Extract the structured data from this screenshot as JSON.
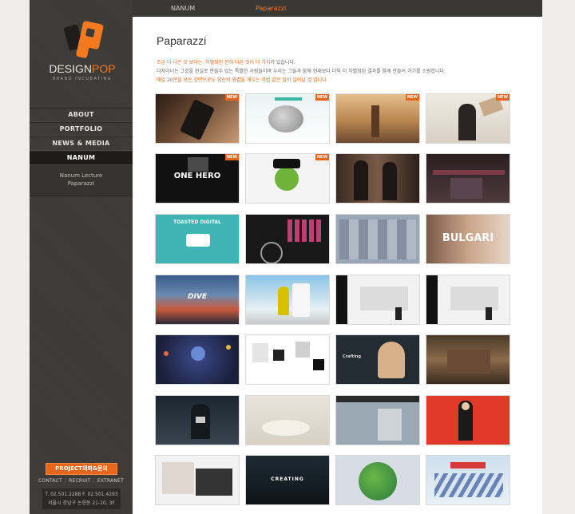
{
  "topbar": {
    "tabs": [
      {
        "label": "NANUM",
        "color": "#d2cdc5"
      },
      {
        "label": "Paparazzi",
        "color": "#f47a1f"
      }
    ]
  },
  "sidebar": {
    "logo": {
      "word1": "DESIGN",
      "word2": "POP",
      "tagline": "BRAND INCUBATING"
    },
    "nav": [
      {
        "label": "ABOUT"
      },
      {
        "label": "PORTFOLIO"
      },
      {
        "label": "NEWS & MEDIA"
      },
      {
        "label": "NANUM"
      }
    ],
    "subnav": [
      {
        "label": "Nanum Lecture"
      },
      {
        "label": "Paparazzi"
      }
    ],
    "project_button": "PROJECT의뢰&문의",
    "footer_links": [
      "CONTACT",
      "RECRUIT",
      "EXTRANET"
    ],
    "contact_line1": "T. 02.501.2288   F. 02.501.4293",
    "contact_line2": "서울시 강남구 논현동 21-10, 3F"
  },
  "main": {
    "title": "Paparazzi",
    "desc_line1_orange": "조금 더 나은 것 보다는, 차별화된 전혀 다른 것이 더 가치",
    "desc_line1_rest": "가 있습니다.",
    "desc_line2": "디자이너는 그것을 현실로 만들수 있는 특별한 사람들이며 우리는 그들과 함께 현재보다 더욱 더 차별화된 결과를 함께 만들어 가기를 소원합니다.",
    "desc_line3": "매일 20분을 보는 것만으로도 당신의 영감을 깨우는 마법 같은 일이 일어날 것 입니다.",
    "new_badge": "NEW",
    "thumb_texts": {
      "one_hero": "ONE HERO",
      "bulgari": "BULGARI",
      "into_the_dive": "DIVE",
      "crafting": "Crafting",
      "toasted": "TOASTED DIGITAL",
      "creating": "CREATING"
    }
  },
  "colors": {
    "accent": "#e8651c",
    "sidebar_bg": "#3c3a37",
    "topbar_bg": "#3a3835"
  }
}
